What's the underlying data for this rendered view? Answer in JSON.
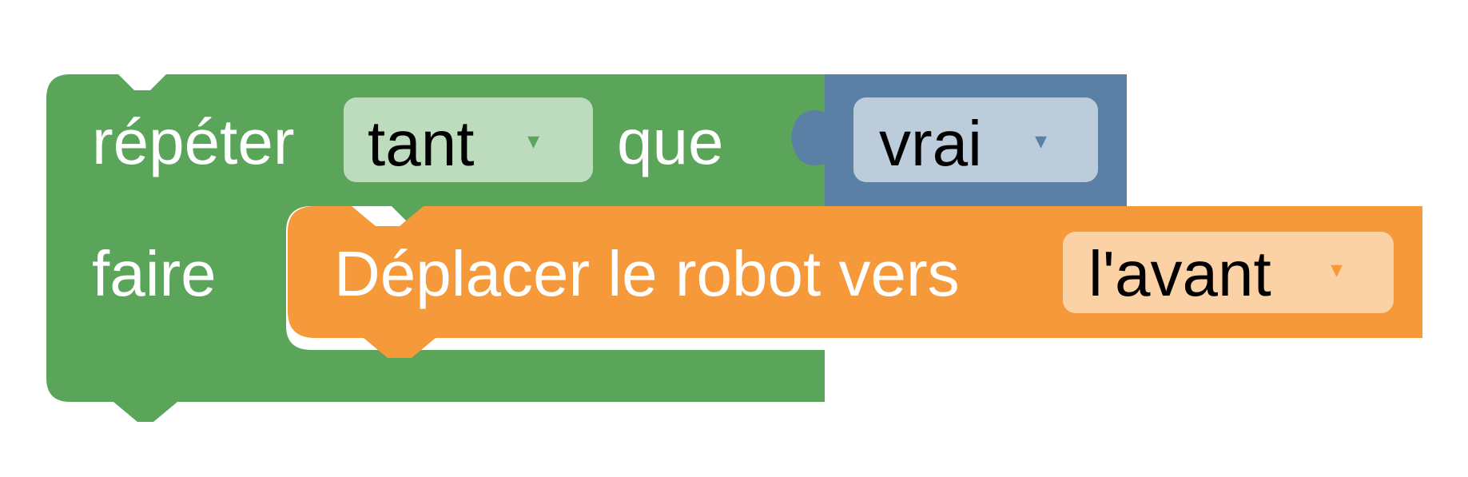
{
  "workspace": {
    "repeat_block": {
      "label_repeat": "répéter",
      "mode_dropdown": {
        "value": "tant",
        "arrow": "▾"
      },
      "label_condition": "que",
      "label_do": "faire",
      "color": "#5ba55b",
      "field_color": "#bddcbd"
    },
    "boolean_block": {
      "value_dropdown": {
        "value": "vrai",
        "arrow": "▾"
      },
      "color": "#5b80a5",
      "field_color": "#bdccdb"
    },
    "move_block": {
      "label": "Déplacer le robot vers",
      "direction_dropdown": {
        "value": "l'avant",
        "arrow": "▾"
      },
      "color": "#f5993b",
      "field_color": "#fbd2a5"
    }
  }
}
